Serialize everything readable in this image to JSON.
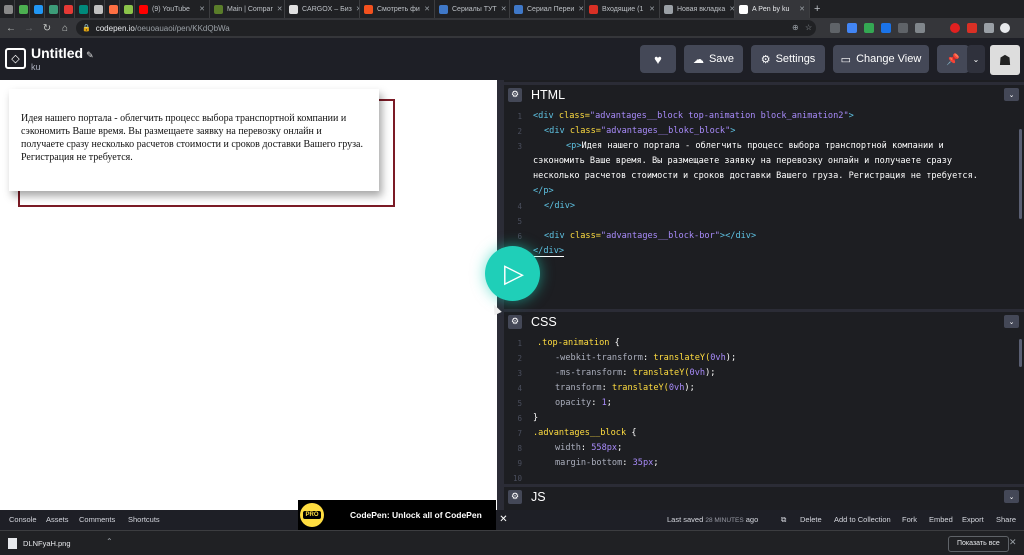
{
  "browser": {
    "tabs": [
      {
        "label": "",
        "color": "#888888"
      },
      {
        "label": "",
        "color": "#4caf50"
      },
      {
        "label": "",
        "color": "#2196f3"
      },
      {
        "label": "",
        "color": "#3c9c78"
      },
      {
        "label": "",
        "color": "#e53935"
      },
      {
        "label": "",
        "color": "#00897b"
      },
      {
        "label": "",
        "color": "#c0c0c0"
      },
      {
        "label": "",
        "color": "#ff7043"
      },
      {
        "label": "",
        "color": "#8bc34a"
      },
      {
        "label": "(9) YouTube",
        "color": "#ff0000"
      },
      {
        "label": "Main | Compar",
        "color": "#5a7d2a"
      },
      {
        "label": "CARGOX – Биз",
        "color": "#e0e0e0"
      },
      {
        "label": "Смотреть фи",
        "color": "#f4511e"
      },
      {
        "label": "Сериалы ТУТ",
        "color": "#3f78c8"
      },
      {
        "label": "Сериал Переи",
        "color": "#3f78c8"
      },
      {
        "label": "Входящие (1",
        "color": "#d93025"
      },
      {
        "label": "Новая вкладка",
        "color": "#9aa0a6"
      },
      {
        "label": "A Pen by ku",
        "color": "#ffffff"
      }
    ],
    "url_host": "codepen.io",
    "url_path": "/oeuoauaoi/pen/KKdQbWa"
  },
  "header": {
    "title": "Untitled",
    "user": "ku",
    "buttons": {
      "save": "Save",
      "settings": "Settings",
      "change_view": "Change View"
    }
  },
  "preview": {
    "text": "Идея нашего портала - облегчить процесс выбора транспортной компании и сэкономить Ваше время. Вы размещаете заявку на перевозку онлайн и получаете сразу несколько расчетов стоимости и сроков доставки Вашего груза. Регистрация не требуется."
  },
  "editors": {
    "html_title": "HTML",
    "css_title": "CSS",
    "js_title": "JS",
    "html_lines": [
      "1",
      "2",
      "3",
      "4",
      "5",
      "6",
      "7"
    ],
    "css_lines": [
      "1",
      "2",
      "3",
      "4",
      "5",
      "6",
      "7",
      "8",
      "9",
      "10"
    ]
  },
  "html_code": {
    "l1_tag_open": "<div",
    "l1_attr": " class=",
    "l1_str": "\"advantages__block top-animation block_animation2\"",
    "l1_close": ">",
    "l2_tag_open": "<div",
    "l2_attr": " class=",
    "l2_str": "\"advantages__blokc_block\"",
    "l2_close": ">",
    "l3_tag": "<p>",
    "l3_text": "Идея нашего портала - облегчить процесс выбора транспортной компании и",
    "l3b_text": "сэкономить Ваше время. Вы размещаете заявку на перевозку онлайн и получаете сразу",
    "l3c_text": "несколько расчетов стоимости и сроков доставки Вашего груза. Регистрация не требуется.",
    "l3d_tag": "</p>",
    "l4_tag": "</div>",
    "l6_tag_open": "<div",
    "l6_attr": " class=",
    "l6_str": "\"advantages__block-bor\"",
    "l6_close": "></div>",
    "l7_tag": "</div>"
  },
  "css_code": {
    "l1_sel": ".top-animation",
    "l1_brace": " {",
    "l2_prop": "-webkit-transform",
    "l2_val": "translateY(",
    "l2_num": "0vh",
    "l2_end": ");",
    "l3_prop": "-ms-transform",
    "l3_val": "translateY(",
    "l3_num": "0vh",
    "l3_end": ");",
    "l4_prop": "transform",
    "l4_val": "translateY(",
    "l4_num": "0vh",
    "l4_end": ");",
    "l5_prop": "opacity",
    "l5_num": "1",
    "l5_end": ";",
    "l6_brace": "}",
    "l7_sel": ".advantages__block",
    "l7_brace": " {",
    "l8_prop": "width",
    "l8_num": "558px",
    "l8_end": ";",
    "l9_prop": "margin-bottom",
    "l9_num": "35px",
    "l9_end": ";"
  },
  "footer": {
    "console": "Console",
    "assets": "Assets",
    "comments": "Comments",
    "shortcuts": "Shortcuts",
    "last_saved_prefix": "Last saved",
    "last_saved_time": "28 MINUTES",
    "last_saved_suffix": "ago",
    "delete": "Delete",
    "add_to_collection": "Add to Collection",
    "fork": "Fork",
    "embed": "Embed",
    "export": "Export",
    "share": "Share"
  },
  "promo": {
    "badge": "PRO",
    "text": "CodePen: Unlock all of CodePen"
  },
  "downloads": {
    "file": "DLNFyaH.png",
    "show_all": "Показать все"
  }
}
